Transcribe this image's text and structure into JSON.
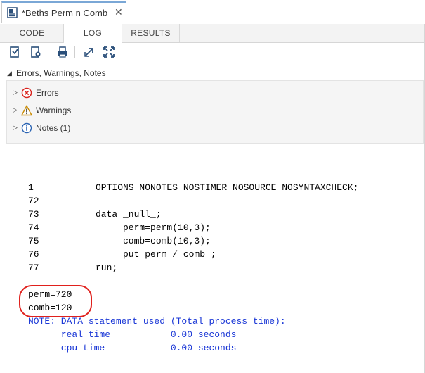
{
  "document_tab": {
    "title": "*Beths Perm n Comb",
    "close_icon": "close-icon"
  },
  "subtabs": [
    {
      "label": "CODE"
    },
    {
      "label": "LOG"
    },
    {
      "label": "RESULTS"
    }
  ],
  "toolbar": {
    "icons": [
      "log-icon",
      "log-settings-icon",
      "print-icon",
      "expand-icon",
      "maximize-icon"
    ]
  },
  "messages_panel": {
    "header": "Errors, Warnings, Notes",
    "rows": [
      {
        "label": "Errors",
        "icon": "error-icon"
      },
      {
        "label": "Warnings",
        "icon": "warning-icon"
      },
      {
        "label": "Notes (1)",
        "icon": "info-icon"
      }
    ]
  },
  "log": {
    "lines": [
      {
        "num": "1",
        "code": "OPTIONS NONOTES NOSTIMER NOSOURCE NOSYNTAXCHECK;"
      },
      {
        "num": "72",
        "code": ""
      },
      {
        "num": "73",
        "code": "data _null_;"
      },
      {
        "num": "74",
        "code": "     perm=perm(10,3);"
      },
      {
        "num": "75",
        "code": "     comb=comb(10,3);"
      },
      {
        "num": "76",
        "code": "     put perm=/ comb=;"
      },
      {
        "num": "77",
        "code": "run;"
      }
    ],
    "output": [
      "perm=720",
      "comb=120"
    ],
    "notes": [
      "NOTE: DATA statement used (Total process time):",
      "      real time           0.00 seconds",
      "      cpu time            0.00 seconds"
    ]
  },
  "colors": {
    "accent": "#7aa7d6",
    "note_text": "#1a37d6",
    "highlight": "#e0201c"
  }
}
